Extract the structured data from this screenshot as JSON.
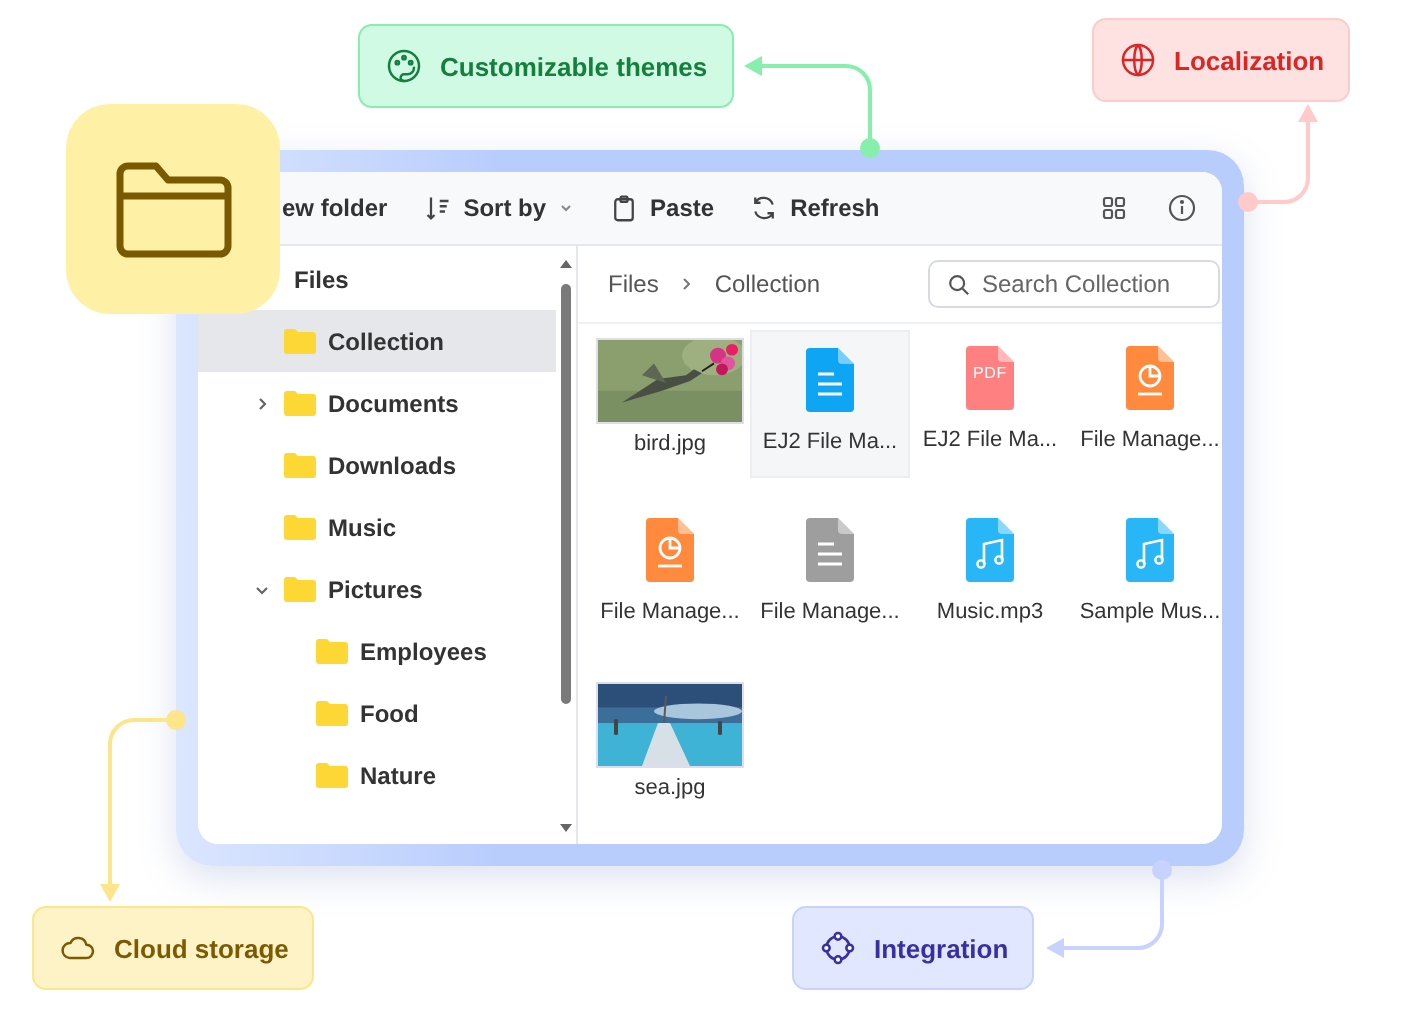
{
  "toolbar": {
    "items": [
      {
        "kind": "new",
        "label": "ew folder"
      },
      {
        "kind": "sort",
        "label": "Sort by"
      },
      {
        "kind": "paste",
        "label": "Paste"
      },
      {
        "kind": "refresh",
        "label": "Refresh"
      }
    ]
  },
  "tree": {
    "label": "Files",
    "kind": "root",
    "selected": false,
    "children": [
      {
        "label": "Collection",
        "kind": "leaf",
        "selected": true
      },
      {
        "label": "Documents",
        "kind": "branch",
        "expanded": false,
        "selected": false
      },
      {
        "label": "Downloads",
        "kind": "leaf",
        "selected": false
      },
      {
        "label": "Music",
        "kind": "leaf",
        "selected": false
      },
      {
        "label": "Pictures",
        "kind": "branch",
        "expanded": true,
        "selected": false,
        "children": [
          {
            "label": "Employees",
            "kind": "leaf",
            "selected": false
          },
          {
            "label": "Food",
            "kind": "leaf",
            "selected": false
          },
          {
            "label": "Nature",
            "kind": "leaf",
            "selected": false
          }
        ]
      }
    ]
  },
  "breadcrumb": [
    {
      "label": "Files"
    },
    {
      "label": "Collection"
    }
  ],
  "search": {
    "placeholder": "Search Collection"
  },
  "files": [
    {
      "kind": "picture",
      "label": "bird.jpg",
      "selected": false
    },
    {
      "kind": "doc",
      "label": "EJ2 File Ma...",
      "selected": true
    },
    {
      "kind": "pdf",
      "label": "EJ2 File Ma...",
      "selected": false,
      "badge": "PDF"
    },
    {
      "kind": "slides",
      "label": "File Manage...",
      "selected": false
    },
    {
      "kind": "slides",
      "label": "File Manage...",
      "selected": false
    },
    {
      "kind": "text",
      "label": "File Manage...",
      "selected": false
    },
    {
      "kind": "music",
      "label": "Music.mp3",
      "selected": false
    },
    {
      "kind": "music",
      "label": "Sample Mus...",
      "selected": false
    },
    {
      "kind": "picture",
      "label": "sea.jpg",
      "selected": false
    }
  ],
  "callouts": [
    {
      "kind": "themes",
      "label": "Customizable themes"
    },
    {
      "kind": "localization",
      "label": "Localization"
    },
    {
      "kind": "cloud",
      "label": "Cloud storage"
    },
    {
      "kind": "integration",
      "label": "Integration"
    }
  ]
}
